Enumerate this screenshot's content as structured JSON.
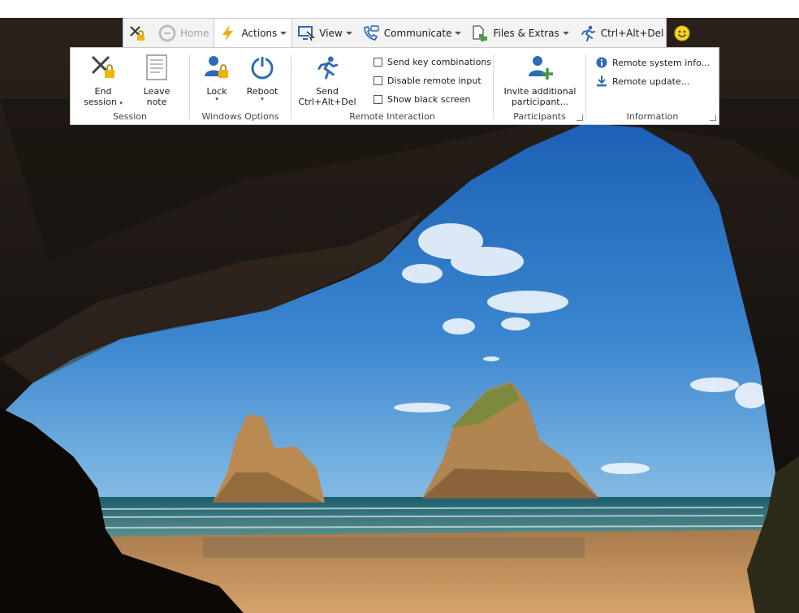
{
  "tabs": {
    "home": {
      "label": "Home",
      "disabled": true
    },
    "actions": {
      "label": "Actions",
      "active": true
    },
    "view": {
      "label": "View"
    },
    "communicate": {
      "label": "Communicate"
    },
    "files": {
      "label": "Files & Extras"
    },
    "cad": {
      "label": "Ctrl+Alt+Del"
    }
  },
  "ribbon": {
    "session": {
      "caption": "Session",
      "end_session": {
        "line1": "End",
        "line2": "session",
        "dropdown": "▾"
      },
      "leave_note": {
        "label": "Leave note"
      }
    },
    "windows_options": {
      "caption": "Windows Options",
      "lock": {
        "label": "Lock",
        "dropdown": "▾"
      },
      "reboot": {
        "label": "Reboot",
        "dropdown": "▾"
      }
    },
    "remote_interaction": {
      "caption": "Remote Interaction",
      "send_cad": {
        "line1": "Send",
        "line2": "Ctrl+Alt+Del"
      },
      "send_key_combinations": {
        "label": "Send key combinations",
        "checked": false
      },
      "disable_remote_input": {
        "label": "Disable remote input",
        "checked": false
      },
      "show_black_screen": {
        "label": "Show black screen",
        "checked": false
      }
    },
    "participants": {
      "caption": "Participants",
      "invite": {
        "line1": "Invite additional",
        "line2": "participant..."
      }
    },
    "information": {
      "caption": "Information",
      "remote_system_info": {
        "label": "Remote system info..."
      },
      "remote_update": {
        "label": "Remote update..."
      }
    }
  },
  "colors": {
    "accent_blue": "#2c6cb6",
    "lightning_orange": "#f2a900",
    "sky": "#3f86d0",
    "sand": "#c99a62"
  },
  "icons": [
    "close-lock-icon",
    "home-icon",
    "lightning-icon",
    "view-icon",
    "communicate-icon",
    "files-extras-icon",
    "running-man-icon",
    "smiley-icon",
    "end-session-icon",
    "note-icon",
    "lock-user-icon",
    "power-icon",
    "invite-user-icon",
    "info-icon",
    "download-icon"
  ]
}
